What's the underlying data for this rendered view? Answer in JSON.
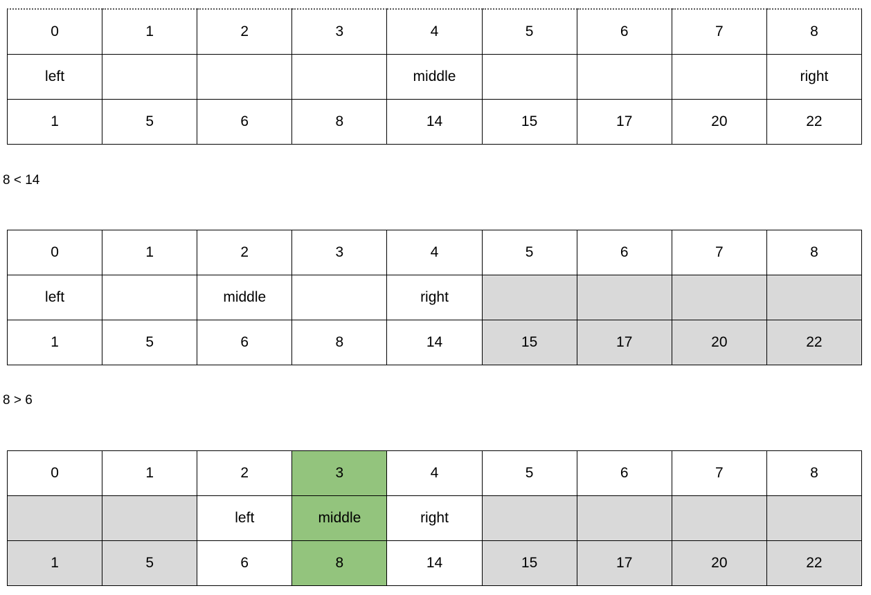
{
  "tables": [
    {
      "id": "table-1",
      "name": "binary-search-step-1",
      "rows": [
        {
          "name": "index-row",
          "cells": [
            {
              "text": "0",
              "fill": "none"
            },
            {
              "text": "1",
              "fill": "none"
            },
            {
              "text": "2",
              "fill": "none"
            },
            {
              "text": "3",
              "fill": "none"
            },
            {
              "text": "4",
              "fill": "none"
            },
            {
              "text": "5",
              "fill": "none"
            },
            {
              "text": "6",
              "fill": "none"
            },
            {
              "text": "7",
              "fill": "none"
            },
            {
              "text": "8",
              "fill": "none"
            }
          ]
        },
        {
          "name": "pointer-row",
          "cells": [
            {
              "text": "left",
              "fill": "none"
            },
            {
              "text": "",
              "fill": "none"
            },
            {
              "text": "",
              "fill": "none"
            },
            {
              "text": "",
              "fill": "none"
            },
            {
              "text": "middle",
              "fill": "none"
            },
            {
              "text": "",
              "fill": "none"
            },
            {
              "text": "",
              "fill": "none"
            },
            {
              "text": "",
              "fill": "none"
            },
            {
              "text": "right",
              "fill": "none"
            }
          ]
        },
        {
          "name": "value-row",
          "cells": [
            {
              "text": "1",
              "fill": "none"
            },
            {
              "text": "5",
              "fill": "none"
            },
            {
              "text": "6",
              "fill": "none"
            },
            {
              "text": "8",
              "fill": "none"
            },
            {
              "text": "14",
              "fill": "none"
            },
            {
              "text": "15",
              "fill": "none"
            },
            {
              "text": "17",
              "fill": "none"
            },
            {
              "text": "20",
              "fill": "none"
            },
            {
              "text": "22",
              "fill": "none"
            }
          ]
        }
      ]
    },
    {
      "id": "table-2",
      "name": "binary-search-step-2",
      "rows": [
        {
          "name": "index-row",
          "cells": [
            {
              "text": "0",
              "fill": "none"
            },
            {
              "text": "1",
              "fill": "none"
            },
            {
              "text": "2",
              "fill": "none"
            },
            {
              "text": "3",
              "fill": "none"
            },
            {
              "text": "4",
              "fill": "none"
            },
            {
              "text": "5",
              "fill": "none"
            },
            {
              "text": "6",
              "fill": "none"
            },
            {
              "text": "7",
              "fill": "none"
            },
            {
              "text": "8",
              "fill": "none"
            }
          ]
        },
        {
          "name": "pointer-row",
          "cells": [
            {
              "text": "left",
              "fill": "none"
            },
            {
              "text": "",
              "fill": "none"
            },
            {
              "text": "middle",
              "fill": "none"
            },
            {
              "text": "",
              "fill": "none"
            },
            {
              "text": "right",
              "fill": "none"
            },
            {
              "text": "",
              "fill": "gray"
            },
            {
              "text": "",
              "fill": "gray"
            },
            {
              "text": "",
              "fill": "gray"
            },
            {
              "text": "",
              "fill": "gray"
            }
          ]
        },
        {
          "name": "value-row",
          "cells": [
            {
              "text": "1",
              "fill": "none"
            },
            {
              "text": "5",
              "fill": "none"
            },
            {
              "text": "6",
              "fill": "none"
            },
            {
              "text": "8",
              "fill": "none"
            },
            {
              "text": "14",
              "fill": "none"
            },
            {
              "text": "15",
              "fill": "gray"
            },
            {
              "text": "17",
              "fill": "gray"
            },
            {
              "text": "20",
              "fill": "gray"
            },
            {
              "text": "22",
              "fill": "gray"
            }
          ]
        }
      ]
    },
    {
      "id": "table-3",
      "name": "binary-search-step-3",
      "rows": [
        {
          "name": "index-row",
          "cells": [
            {
              "text": "0",
              "fill": "none"
            },
            {
              "text": "1",
              "fill": "none"
            },
            {
              "text": "2",
              "fill": "none"
            },
            {
              "text": "3",
              "fill": "green"
            },
            {
              "text": "4",
              "fill": "none"
            },
            {
              "text": "5",
              "fill": "none"
            },
            {
              "text": "6",
              "fill": "none"
            },
            {
              "text": "7",
              "fill": "none"
            },
            {
              "text": "8",
              "fill": "none"
            }
          ]
        },
        {
          "name": "pointer-row",
          "cells": [
            {
              "text": "",
              "fill": "gray"
            },
            {
              "text": "",
              "fill": "gray"
            },
            {
              "text": "left",
              "fill": "none"
            },
            {
              "text": "middle",
              "fill": "green"
            },
            {
              "text": "right",
              "fill": "none"
            },
            {
              "text": "",
              "fill": "gray"
            },
            {
              "text": "",
              "fill": "gray"
            },
            {
              "text": "",
              "fill": "gray"
            },
            {
              "text": "",
              "fill": "gray"
            }
          ]
        },
        {
          "name": "value-row",
          "cells": [
            {
              "text": "1",
              "fill": "gray"
            },
            {
              "text": "5",
              "fill": "gray"
            },
            {
              "text": "6",
              "fill": "none"
            },
            {
              "text": "8",
              "fill": "green"
            },
            {
              "text": "14",
              "fill": "none"
            },
            {
              "text": "15",
              "fill": "gray"
            },
            {
              "text": "17",
              "fill": "gray"
            },
            {
              "text": "20",
              "fill": "gray"
            },
            {
              "text": "22",
              "fill": "gray"
            }
          ]
        }
      ]
    }
  ],
  "notes": {
    "note_1": "8 < 14",
    "note_2": "8 > 6"
  },
  "colors": {
    "highlight_green": "#93c47d",
    "excluded_gray": "#d9d9d9",
    "border": "#000000",
    "text": "#000000",
    "background": "#ffffff"
  }
}
